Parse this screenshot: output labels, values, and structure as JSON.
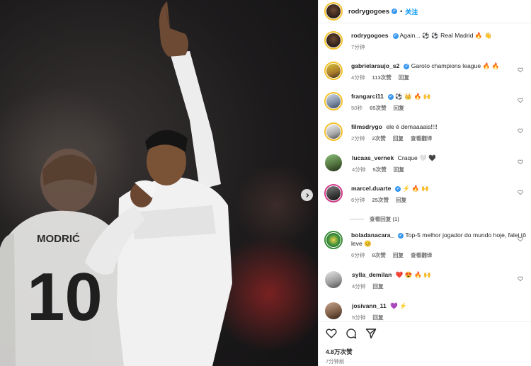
{
  "post": {
    "jersey_name": "MODRIĆ",
    "jersey_number": "10"
  },
  "header": {
    "username": "rodrygogoes",
    "separator": "•",
    "follow_label": "关注"
  },
  "comments": [
    {
      "user": "rodrygogoes",
      "text": "Again... ⚽ ⚽ Real Madrid 🔥 👋",
      "time": "7分钟",
      "likes": "",
      "reply": "",
      "translate": ""
    },
    {
      "user": "gabrielaraujo_s2",
      "text": "Garoto champions league 🔥 🔥",
      "time": "4分钟",
      "likes": "113次赞",
      "reply": "回复",
      "translate": ""
    },
    {
      "user": "frangarci11",
      "text": "⚽ 👑 🔥 🙌",
      "time": "50秒",
      "likes": "65次赞",
      "reply": "回复",
      "translate": ""
    },
    {
      "user": "filmsdrygo",
      "text": "ele é demaaaais!!!!",
      "time": "2分钟",
      "likes": "2次赞",
      "reply": "回复",
      "translate": "查看翻译"
    },
    {
      "user": "lucaas_vernek",
      "text": "Craque 🤍 🖤",
      "time": "4分钟",
      "likes": "5次赞",
      "reply": "回复",
      "translate": ""
    },
    {
      "user": "marcel.duarte",
      "text": "⚡ 🔥 🙌",
      "time": "6分钟",
      "likes": "25次赞",
      "reply": "回复",
      "translate": ""
    },
    {
      "user": "boladanacara_",
      "text": "Top-5 melhor jogador do mundo hoje, falei tô leve 😊",
      "time": "6分钟",
      "likes": "8次赞",
      "reply": "回复",
      "translate": "查看翻译"
    },
    {
      "user": "sylla_demilan",
      "text": "❤️ 😍 🔥 🙌",
      "time": "4分钟",
      "likes": "",
      "reply": "回复",
      "translate": ""
    },
    {
      "user": "josivann_11",
      "text": "💜 ⚡",
      "time": "5分钟",
      "likes": "",
      "reply": "回复",
      "translate": ""
    }
  ],
  "view_replies_label": "查看回复 (1)",
  "footer": {
    "likes": "4.8万次赞",
    "ago": "7分钟前"
  },
  "colors": {
    "link": "#0095f6",
    "verified": "#3897f0",
    "meta": "#737373"
  },
  "icons": [
    "heart-icon",
    "comment-icon",
    "share-icon",
    "chevron-right-icon",
    "verified-icon"
  ]
}
